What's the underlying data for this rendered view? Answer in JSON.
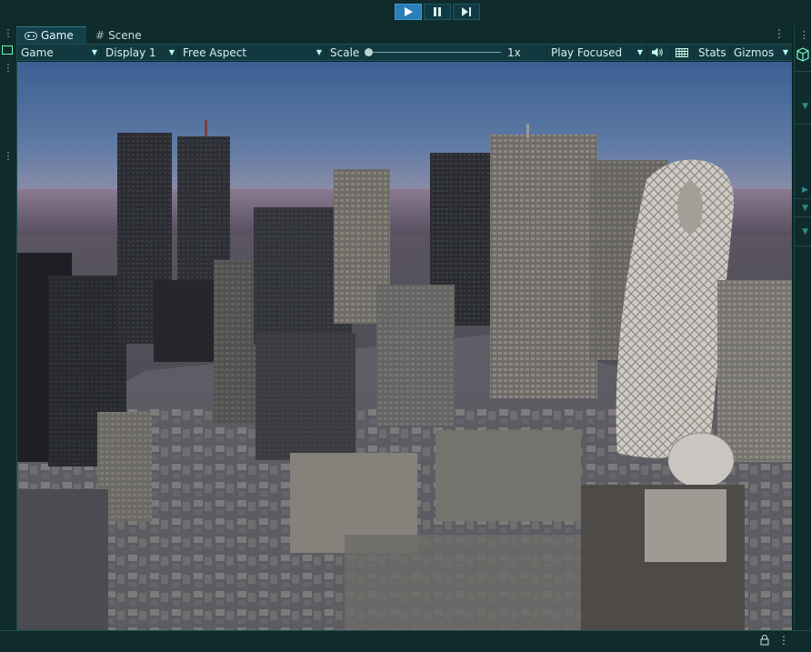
{
  "playbar": {
    "play_icon": "play-icon",
    "pause_icon": "pause-icon",
    "step_icon": "step-icon"
  },
  "tabs": [
    {
      "label": "Game",
      "icon": "gamepad-icon",
      "active": true
    },
    {
      "label": "Scene",
      "icon": "hash-icon",
      "active": false
    }
  ],
  "toolbar": {
    "game_dropdown": "Game",
    "display_dropdown": "Display 1",
    "aspect_dropdown": "Free Aspect",
    "scale_label": "Scale",
    "scale_value": "1x",
    "scale_fraction": 0,
    "play_mode_dropdown": "Play Focused",
    "audio_icon": "speaker-icon",
    "keyboard_icon": "keyboard-icon",
    "stats_label": "Stats",
    "gizmos_label": "Gizmos"
  },
  "colors": {
    "accent": "#2a7fb8",
    "panel_bg": "#0f2b2b",
    "toolbar_bg": "#12393f"
  },
  "viewport": {
    "content": "rendered 3D city skyline scene"
  },
  "status": {
    "lock_icon": "lock-icon",
    "menu_icon": "kebab-icon"
  }
}
